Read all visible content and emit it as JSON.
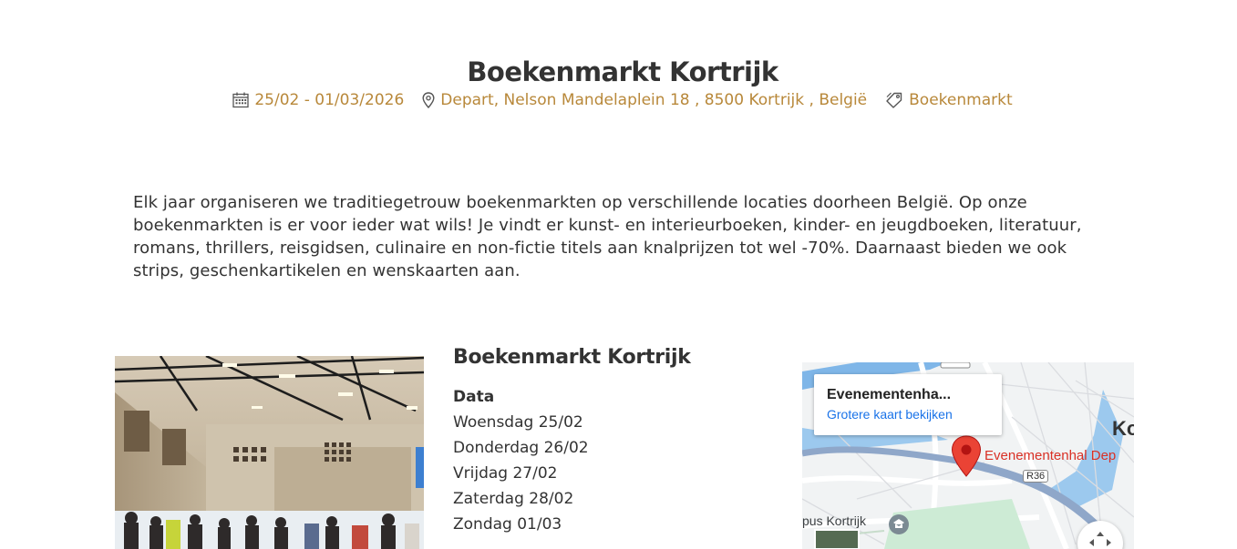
{
  "event": {
    "title": "Boekenmarkt Kortrijk",
    "date_range": "25/02 - 01/03/2026",
    "location": "Depart, Nelson Mandelaplein 18 , 8500 Kortrijk , België",
    "category": "Boekenmarkt"
  },
  "intro": "Elk jaar organiseren we traditiegetrouw boekenmarkten op verschillende locaties doorheen België. Op onze boekenmarkten is er voor ieder wat wils! Je vindt er kunst- en interieurboeken, kinder- en jeugdboeken, literatuur, romans, thrillers, reisgidsen, culinaire en non-fictie titels aan knalprijzen tot wel -70%. Daarnaast bieden we ook strips, geschenkartikelen en wenskaarten aan.",
  "info": {
    "title": "Boekenmarkt Kortrijk",
    "dates_label": "Data",
    "days": [
      "Woensdag 25/02",
      "Donderdag 26/02",
      "Vrijdag 27/02",
      "Zaterdag 28/02",
      "Zondag 01/03"
    ]
  },
  "map": {
    "card_title": "Evenementenha...",
    "card_link": "Grotere kaart bekijken",
    "venue_label": "Evenementenhal Dep",
    "city_label": "Ko",
    "road_label": "R36",
    "campus_label": "pus Kortrijk"
  },
  "colors": {
    "accent": "#b8883a",
    "text": "#333333",
    "link": "#1a73e8",
    "marker": "#ea4335"
  },
  "icons": {
    "date": "calendar-icon",
    "location": "map-pin-icon",
    "category": "tag-icon",
    "map_marker": "map-marker-icon",
    "fullscreen": "fullscreen-icon"
  }
}
